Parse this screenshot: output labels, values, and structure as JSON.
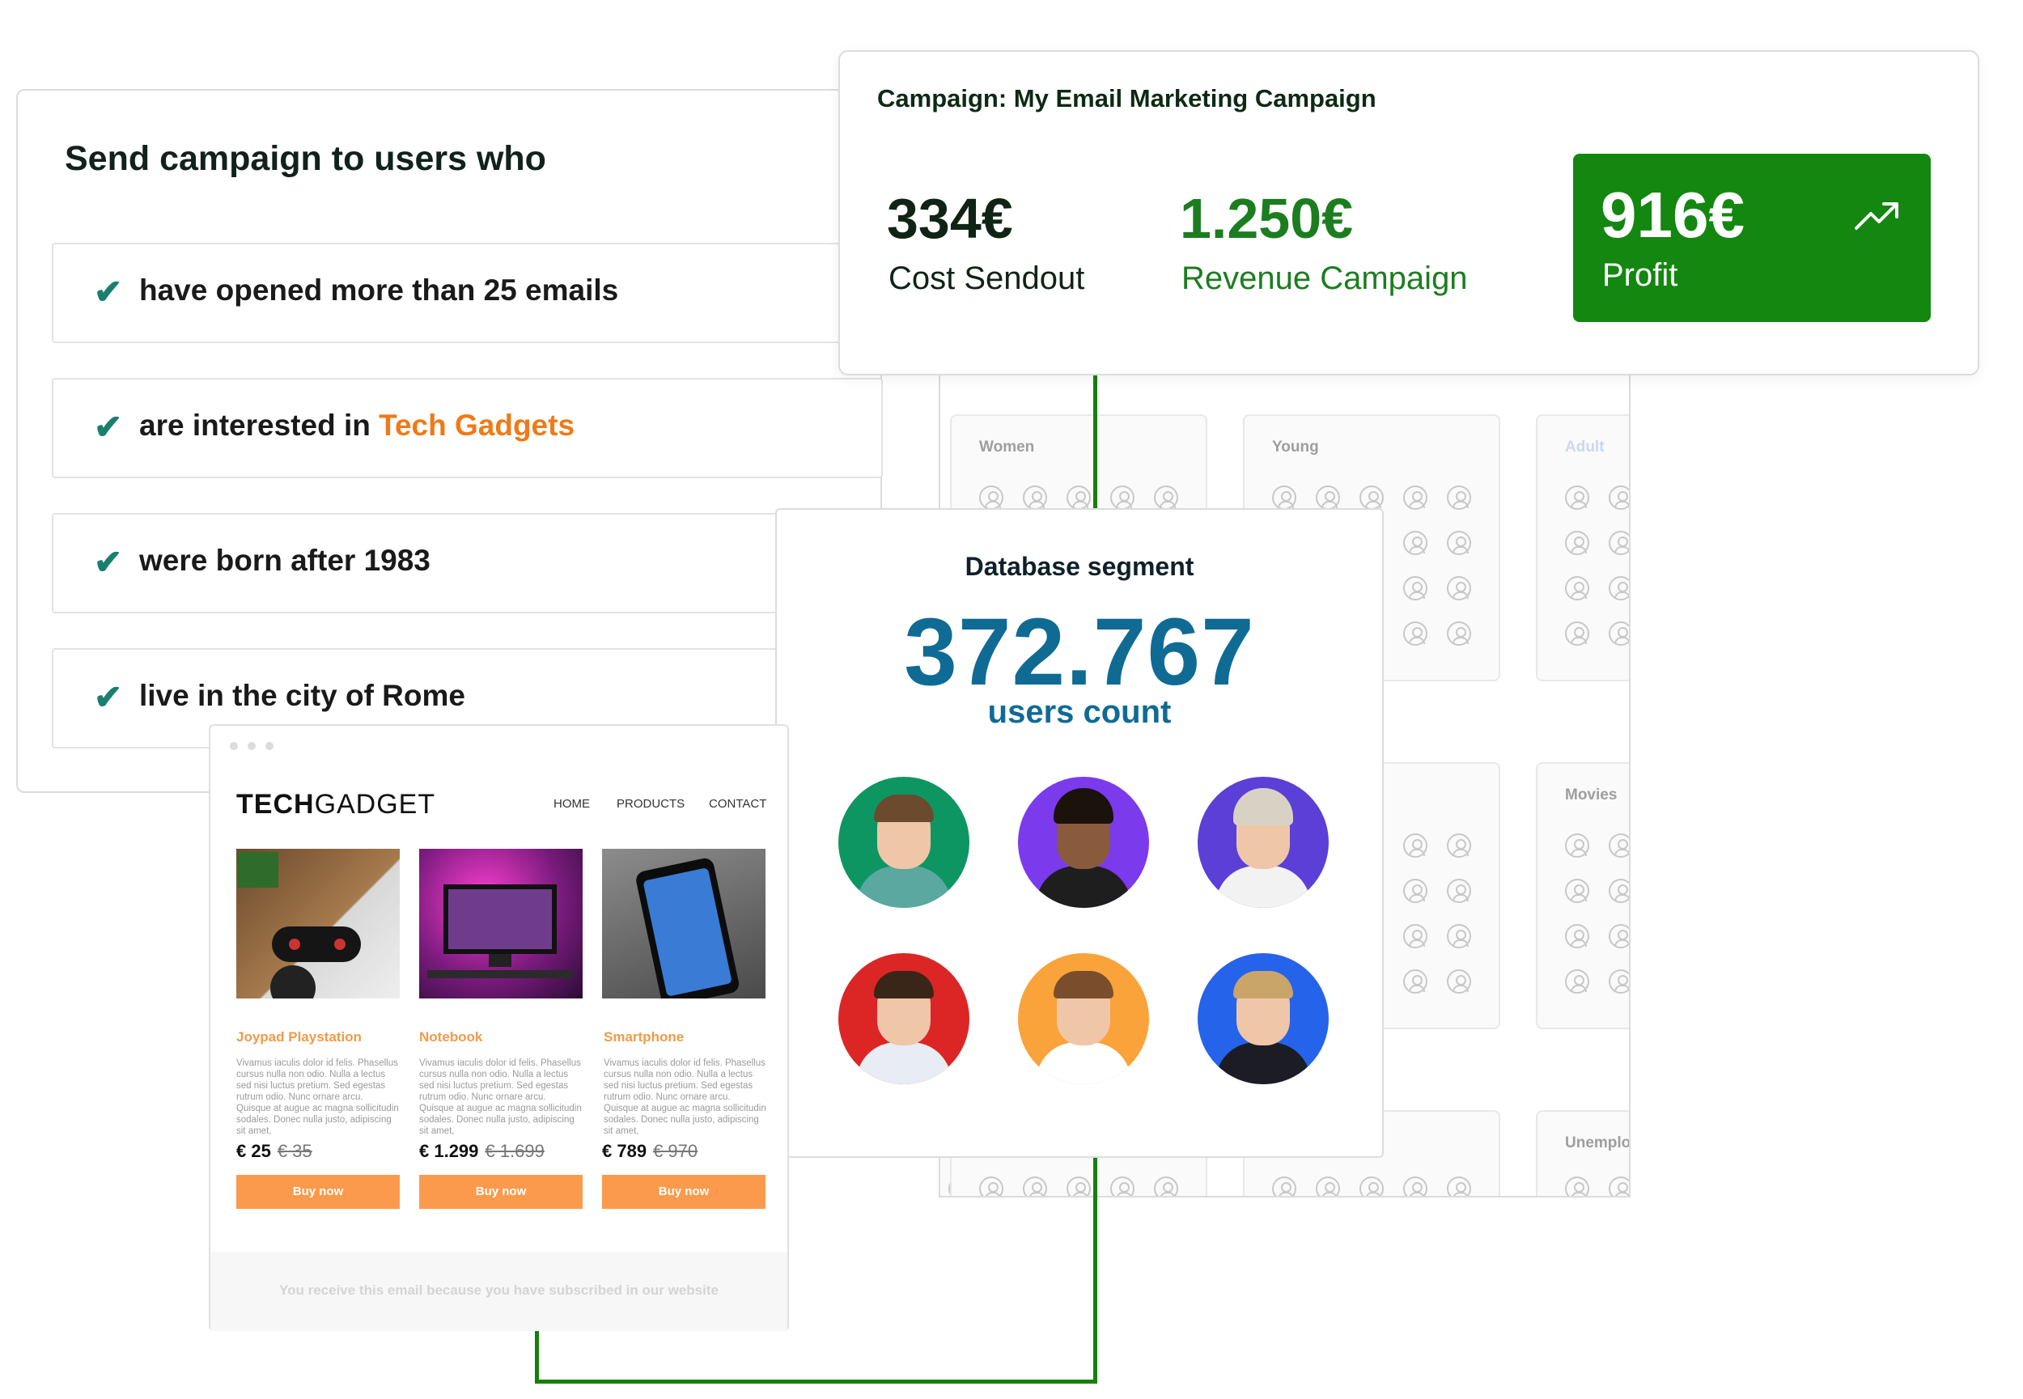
{
  "criteria": {
    "title": "Send campaign to users who",
    "rows": [
      {
        "prefix": "have opened more than 25 emails",
        "highlight": ""
      },
      {
        "prefix": "are interested in ",
        "highlight": "Tech Gadgets"
      },
      {
        "prefix": "were born after 1983",
        "highlight": ""
      },
      {
        "prefix": "live in the city of Rome",
        "highlight": ""
      }
    ],
    "check_glyph": "✔"
  },
  "campaign": {
    "title": "Campaign: My Email Marketing Campaign",
    "cost": {
      "value": "334€",
      "label": "Cost Sendout"
    },
    "revenue": {
      "value": "1.250€",
      "label": "Revenue Campaign"
    },
    "profit": {
      "value": "916€",
      "label": "Profit",
      "icon": "trending-up-icon"
    }
  },
  "segments": {
    "labels": [
      "Women",
      "Young",
      "Adult",
      "Movies",
      "Unemplo"
    ]
  },
  "database_segment": {
    "title": "Database segment",
    "count": "372.767",
    "count_label": "users count"
  },
  "email": {
    "logo_bold": "TECH",
    "logo_rest": "GADGET",
    "nav": [
      "HOME",
      "PRODUCTS",
      "CONTACT"
    ],
    "products": [
      {
        "name": "Joypad Playstation",
        "price": "€ 25",
        "old_price": "€ 35",
        "button": "Buy now",
        "desc": "Vivamus iaculis dolor id felis. Phasellus cursus nulla non odio. Nulla a lectus sed nisi luctus pretium. Sed egestas rutrum odio. Nunc ornare arcu. Quisque at augue ac magna sollicitudin sodales. Donec nulla justo, adipiscing sit amet,"
      },
      {
        "name": "Notebook",
        "price": "€ 1.299",
        "old_price": "€ 1.699",
        "button": "Buy now",
        "desc": "Vivamus iaculis dolor id felis. Phasellus cursus nulla non odio. Nulla a lectus sed nisi luctus pretium. Sed egestas rutrum odio. Nunc ornare arcu. Quisque at augue ac magna sollicitudin sodales. Donec nulla justo, adipiscing sit amet,"
      },
      {
        "name": "Smartphone",
        "price": "€ 789",
        "old_price": "€ 970",
        "button": "Buy now",
        "desc": "Vivamus iaculis dolor id felis. Phasellus cursus nulla non odio. Nulla a lectus sed nisi luctus pretium. Sed egestas rutrum odio. Nunc ornare arcu. Quisque at augue ac magna sollicitudin sodales. Donec nulla justo, adipiscing sit amet,"
      }
    ],
    "footer": "You receive this email because you have subscribed in our website"
  },
  "colors": {
    "accent_green": "#138710",
    "count_blue": "#0f6b94",
    "highlight_orange": "#ef7a18",
    "button_orange": "#fb9a4d"
  }
}
